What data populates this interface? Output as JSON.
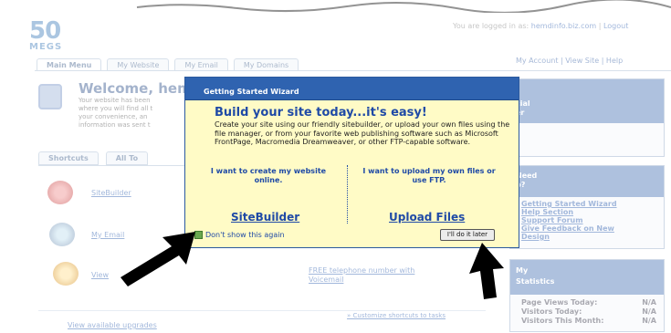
{
  "header": {
    "logo_number": "50",
    "logo_sub": "MEGS",
    "logged_in_prefix": "You are logged in as:",
    "logged_in_user": "hemdinfo.biz.com",
    "logout": "Logout"
  },
  "tabs": [
    "Main Menu",
    "My Website",
    "My Email",
    "My Domains"
  ],
  "top_right_links": "My Account | View Site | Help",
  "welcome": {
    "title": "Welcome, hem",
    "lines": [
      "Your website has been",
      "where you will find all t",
      "your convenience, an",
      "information was sent t"
    ]
  },
  "shortcut_tabs": [
    "Shortcuts",
    "All To"
  ],
  "shortcuts": {
    "sitebuilder": "SiteBuilder",
    "my_email": "My Email",
    "view": "View",
    "toll_free": "FREE telephone number with",
    "toll_free_2": "Voicemail",
    "customize": "» Customize shortcuts to tasks",
    "upgrades": "View available upgrades"
  },
  "right_panels": {
    "special_offer": [
      "cial",
      "er"
    ],
    "need_help": {
      "heading": [
        "Need",
        "p?"
      ],
      "links": [
        "Getting Started Wizard",
        "Help Section",
        "Support Forum",
        "Give Feedback on New",
        "Design"
      ]
    },
    "statistics": {
      "heading": [
        "My",
        "Statistics"
      ],
      "rows": [
        {
          "label": "Page Views Today:",
          "value": "N/A"
        },
        {
          "label": "Visitors Today:",
          "value": "N/A"
        },
        {
          "label": "Visitors This Month:",
          "value": "N/A"
        }
      ]
    }
  },
  "wizard": {
    "title": "Getting Started Wizard",
    "headline": "Build your site today...it's easy!",
    "body": "Create your site using our friendly sitebuilder, or upload your own files using the file manager, or from your favorite web publishing software such as Microsoft FrontPage, Macromedia Dreamweaver, or other FTP-capable software.",
    "left_option": "I want to create my website online.",
    "right_option": "I want to upload my own files or use FTP.",
    "left_link": "SiteBuilder",
    "right_link": "Upload Files",
    "checkbox_label": "Don't show this again",
    "checkbox_checked": true,
    "later_button": "I'll do it later"
  },
  "colors": {
    "titlebar": "#2f63b0",
    "dialog_bg": "#fffbc6",
    "link_blue": "#1f4aa6"
  }
}
